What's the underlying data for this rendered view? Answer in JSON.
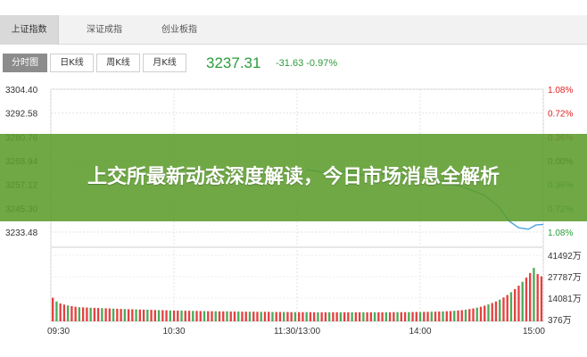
{
  "index_tabs": [
    "上证指数",
    "深证成指",
    "创业板指"
  ],
  "active_index_tab": 0,
  "view_tabs": [
    "分时图",
    "日K线",
    "周K线",
    "月K线"
  ],
  "active_view_tab": 0,
  "quote": {
    "price": "3237.31",
    "change": "-31.63 -0.97%"
  },
  "colors": {
    "up": "#e02020",
    "down": "#2a9d3a",
    "line": "#4aa3df",
    "banner": "#5c9c2c"
  },
  "banner": {
    "title": "上交所最新动态深度解读，今日市场消息全解析"
  },
  "chart_data": [
    {
      "type": "line",
      "title": "",
      "xlabel": "",
      "ylabel": "",
      "x_ticks": [
        "09:30",
        "10:30",
        "11:30/13:00",
        "14:00",
        "15:00"
      ],
      "x_tick_fractions": [
        0,
        0.25,
        0.5,
        0.75,
        1
      ],
      "y_ticks_left": [
        "3304.40",
        "3292.58",
        "3280.76",
        "3268.94",
        "3257.12",
        "3245.30",
        "3233.48"
      ],
      "y_ticks_right": [
        "1.08%",
        "0.72%",
        "0.36%",
        "0.00%",
        "0.36%",
        "0.72%",
        "1.08%"
      ],
      "ylim": [
        3233.48,
        3304.4
      ],
      "grid": true,
      "series": [
        {
          "time_fraction": [
            0.52,
            0.56,
            0.6,
            0.64,
            0.68,
            0.72,
            0.76,
            0.8,
            0.84,
            0.88,
            0.91,
            0.93,
            0.95,
            0.97,
            0.985,
            1.0
          ],
          "price": [
            3264.5,
            3262.8,
            3263.6,
            3261.5,
            3262.2,
            3260.4,
            3261.0,
            3258.5,
            3255.6,
            3251.8,
            3246.0,
            3239.0,
            3235.6,
            3234.9,
            3237.0,
            3237.3
          ]
        }
      ]
    },
    {
      "type": "bar",
      "title": "",
      "xlabel": "",
      "ylabel": "",
      "y_ticks_right": [
        "41492万",
        "27787万",
        "14081万",
        "376万"
      ],
      "ylim": [
        0,
        41492
      ],
      "grid": true,
      "values": [
        15200,
        12800,
        11500,
        10800,
        10200,
        9800,
        9400,
        9100,
        9000,
        8900,
        8800,
        8700,
        8600,
        8500,
        8400,
        8300,
        8200,
        8100,
        8000,
        7900,
        7800,
        7800,
        7700,
        7600,
        7500,
        7500,
        7400,
        7300,
        7200,
        7200,
        7100,
        7000,
        7000,
        6900,
        6900,
        6800,
        6800,
        6700,
        6700,
        6600,
        6600,
        6500,
        6500,
        6500,
        6400,
        6400,
        6400,
        6300,
        6300,
        6300,
        6200,
        6200,
        6200,
        6200,
        6100,
        6100,
        6100,
        6100,
        6000,
        6000,
        6000,
        6000,
        6000,
        5900,
        5900,
        5900,
        5900,
        5900,
        5900,
        5800,
        5800,
        5800,
        5800,
        5800,
        5800,
        5800,
        5800,
        5800,
        5800,
        5800,
        5800,
        5800,
        5800,
        5800,
        5800,
        5800,
        5800,
        5800,
        5800,
        5800,
        5900,
        5900,
        5900,
        5900,
        5900,
        6000,
        6000,
        6000,
        6100,
        6100,
        6200,
        6200,
        6300,
        6400,
        6500,
        6600,
        6800,
        7000,
        7200,
        7500,
        7900,
        8300,
        8800,
        9400,
        10100,
        10900,
        11800,
        12800,
        14000,
        15400,
        17000,
        18800,
        20800,
        23000,
        25500,
        28200,
        31200,
        34500,
        30500,
        29000
      ]
    }
  ]
}
